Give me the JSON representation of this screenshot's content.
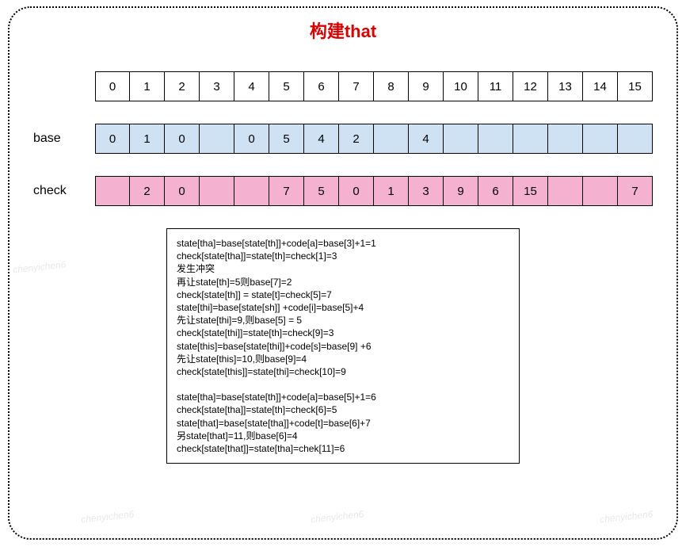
{
  "title": "构建that",
  "labels": {
    "index": "",
    "base": "base",
    "check": "check"
  },
  "arrays": {
    "index": [
      "0",
      "1",
      "2",
      "3",
      "4",
      "5",
      "6",
      "7",
      "8",
      "9",
      "10",
      "11",
      "12",
      "13",
      "14",
      "15"
    ],
    "base": [
      "0",
      "1",
      "0",
      "",
      "0",
      "5",
      "4",
      "2",
      "",
      "4",
      "",
      "",
      "",
      "",
      "",
      ""
    ],
    "check": [
      "",
      "2",
      "0",
      "",
      "",
      "7",
      "5",
      "0",
      "1",
      "3",
      "9",
      "6",
      "15",
      "",
      "",
      "7"
    ]
  },
  "notes": [
    "state[tha]=base[state[th]]+code[a]=base[3]+1=1",
    "check[state[tha]]=state[th]=check[1]=3",
    "发生冲突",
    "再让state[th]=5则base[7]=2",
    "check[state[th]] = state[t]=check[5]=7",
    "state[thi]=base[state[sh]] +code[i]=base[5]+4",
    "先让state[thi]=9,则base[5] = 5",
    "check[state[thi]]=state[th]=check[9]=3",
    "state[this]=base[state[thi]]+code[s]=base[9] +6",
    "先让state[this]=10,则base[9]=4",
    "check[state[this]]=state[thi]=check[10]=9",
    "",
    "state[tha]=base[state[th]]+code[a]=base[5]+1=6",
    "check[state[tha]]=state[th]=check[6]=5",
    "state[that]=base[state[tha]]+code[t]=base[6]+7",
    "另state[that]=11,则base[6]=4",
    "check[state[that]]=state[tha]=chek[11]=6"
  ],
  "watermark": "chenyichen6",
  "chart_data": {
    "type": "table",
    "title": "构建that — base/check arrays for double-array trie",
    "columns": [
      "index",
      "base",
      "check"
    ],
    "rows": [
      {
        "index": 0,
        "base": 0,
        "check": null
      },
      {
        "index": 1,
        "base": 1,
        "check": 2
      },
      {
        "index": 2,
        "base": 0,
        "check": 0
      },
      {
        "index": 3,
        "base": null,
        "check": null
      },
      {
        "index": 4,
        "base": 0,
        "check": null
      },
      {
        "index": 5,
        "base": 5,
        "check": 7
      },
      {
        "index": 6,
        "base": 4,
        "check": 5
      },
      {
        "index": 7,
        "base": 2,
        "check": 0
      },
      {
        "index": 8,
        "base": null,
        "check": 1
      },
      {
        "index": 9,
        "base": 4,
        "check": 3
      },
      {
        "index": 10,
        "base": null,
        "check": 9
      },
      {
        "index": 11,
        "base": null,
        "check": 6
      },
      {
        "index": 12,
        "base": null,
        "check": 15
      },
      {
        "index": 13,
        "base": null,
        "check": null
      },
      {
        "index": 14,
        "base": null,
        "check": null
      },
      {
        "index": 15,
        "base": null,
        "check": 7
      }
    ]
  }
}
